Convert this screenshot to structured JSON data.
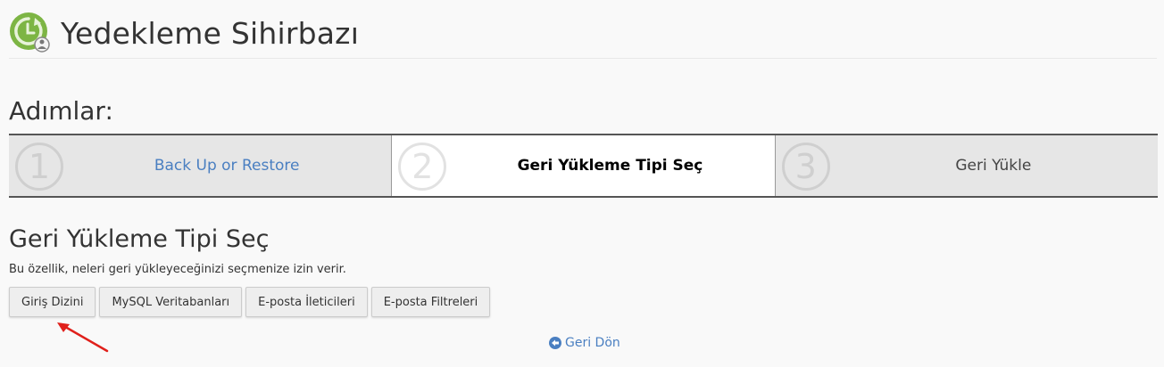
{
  "header": {
    "title": "Yedekleme Sihirbazı",
    "logo_icon": "backup-wizard-icon"
  },
  "steps_heading": "Adımlar:",
  "steps": [
    {
      "number": "1",
      "label": "Back Up or Restore",
      "state": "link"
    },
    {
      "number": "2",
      "label": "Geri Yükleme Tipi Seç",
      "state": "active"
    },
    {
      "number": "3",
      "label": "Geri Yükle",
      "state": "inactive"
    }
  ],
  "section": {
    "title": "Geri Yükleme Tipi Seç",
    "description": "Bu özellik, neleri geri yükleyeceğinizi seçmenize izin verir."
  },
  "buttons": {
    "home_dir": "Giriş Dizini",
    "mysql": "MySQL Veritabanları",
    "forwarders": "E-posta İleticileri",
    "filters": "E-posta Filtreleri"
  },
  "back": {
    "label": "Geri Dön",
    "icon": "arrow-circle-left-icon"
  },
  "colors": {
    "link": "#4a7fc1",
    "annotation_arrow": "#e0201b",
    "logo_green": "#7db544"
  }
}
